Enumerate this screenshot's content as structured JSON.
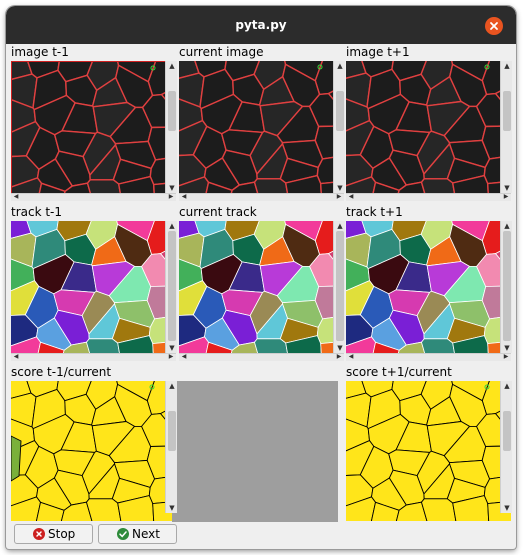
{
  "window": {
    "title": "pyta.py"
  },
  "panels": {
    "image_prev": {
      "label": "image t-1"
    },
    "image_curr": {
      "label": "current image"
    },
    "image_next": {
      "label": "image t+1"
    },
    "track_prev": {
      "label": "track t-1"
    },
    "track_curr": {
      "label": "current track"
    },
    "track_next": {
      "label": "track t+1"
    },
    "score_prev": {
      "label": "score t-1/current"
    },
    "score_next": {
      "label": "score t+1/current"
    }
  },
  "buttons": {
    "stop": {
      "label": "Stop",
      "icon": "stop-circle-icon",
      "color": "#cc1f1f"
    },
    "next": {
      "label": "Next",
      "icon": "check-circle-icon",
      "color": "#2e8b3a"
    }
  },
  "colors": {
    "titlebar": "#2c2c2c",
    "close": "#e95420",
    "cell_outline": "#e03030",
    "score_fill": "#ffe51a"
  }
}
